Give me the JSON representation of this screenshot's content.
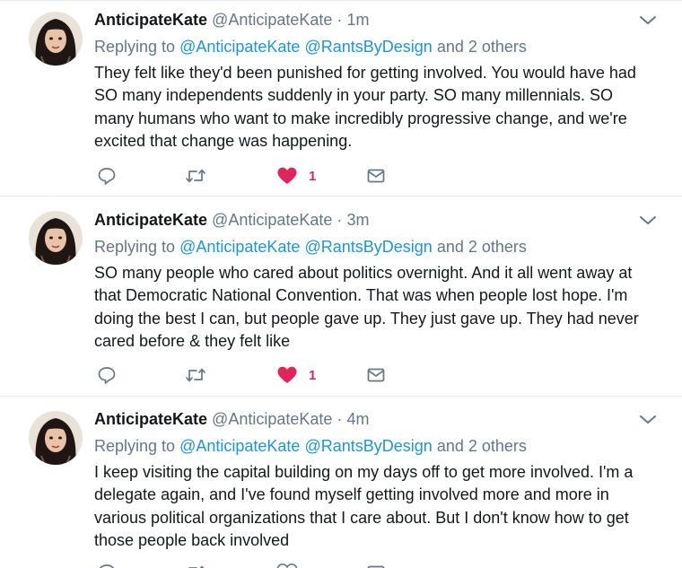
{
  "tweets": [
    {
      "name": "AnticipateKate",
      "handle": "@AnticipateKate",
      "separator": "·",
      "time": "1m",
      "reply_prefix": "Replying to",
      "reply_user1": "@AnticipateKate",
      "reply_user2": "@RantsByDesign",
      "reply_suffix": "and 2 others",
      "lines": [
        "They felt like they'd been punished for getting involved.  You would have had",
        "SO many independents suddenly in your party.  SO many millennials.  SO",
        "many humans who want to make incredibly progressive change, and we're",
        "excited that change was happening."
      ],
      "like_count": "1",
      "liked": true
    },
    {
      "name": "AnticipateKate",
      "handle": "@AnticipateKate",
      "separator": "·",
      "time": "3m",
      "reply_prefix": "Replying to",
      "reply_user1": "@AnticipateKate",
      "reply_user2": "@RantsByDesign",
      "reply_suffix": "and 2 others",
      "lines": [
        "SO many people who cared about politics overnight.  And it all went away at",
        "that Democratic National Convention.  That was when people lost hope.  I'm",
        "doing the best I can, but people gave up.  They just gave up.  They had never",
        "cared before & they felt like"
      ],
      "like_count": "1",
      "liked": true
    },
    {
      "name": "AnticipateKate",
      "handle": "@AnticipateKate",
      "separator": "·",
      "time": "4m",
      "reply_prefix": "Replying to",
      "reply_user1": "@AnticipateKate",
      "reply_user2": "@RantsByDesign",
      "reply_suffix": "and 2 others",
      "lines": [
        "I keep visiting the capital building on my days off to get more involved.  I'm a",
        "delegate again, and I've found myself getting involved more and more in",
        "various political organizations that I care about.  But I don't know how to get",
        "those people back involved"
      ],
      "like_count": "",
      "liked": false
    }
  ],
  "icons": {
    "reply": "reply-icon",
    "retweet": "retweet-icon",
    "like": "heart-icon",
    "dm": "envelope-icon",
    "caret": "chevron-down-icon"
  },
  "colors": {
    "name": "#14171a",
    "secondary": "#657786",
    "link": "#1b95e0",
    "like": "#e0245e",
    "divider": "#e6ecf0"
  }
}
